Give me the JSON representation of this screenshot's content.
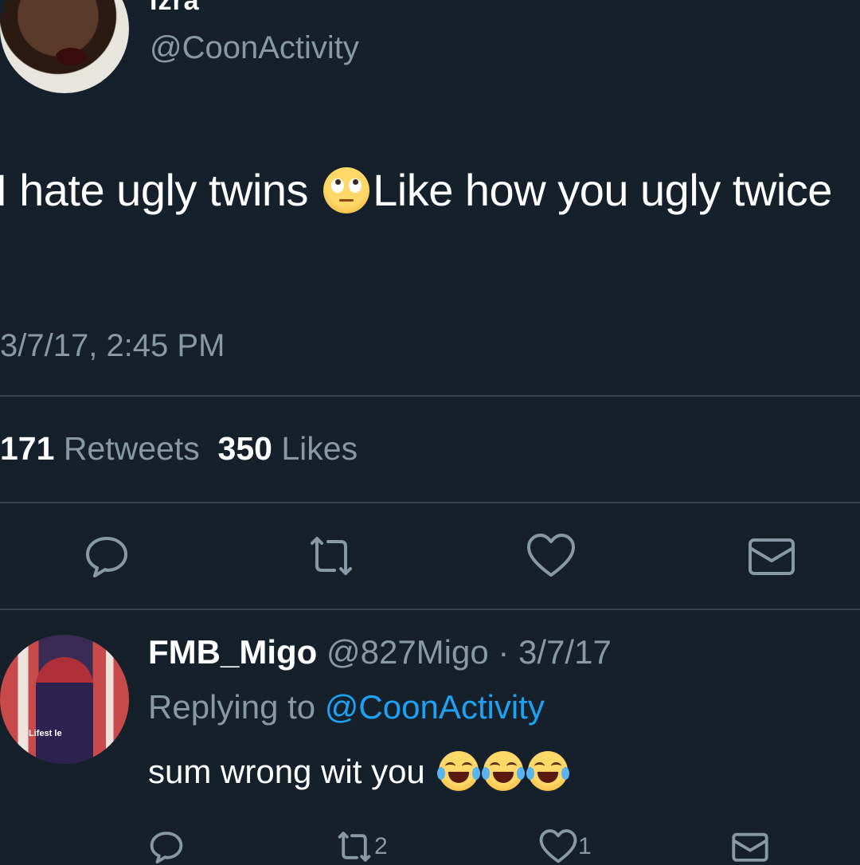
{
  "tweet": {
    "display_name": "Izra",
    "handle": "@CoonActivity",
    "text_part1": "I hate ugly twins ",
    "text_part2": "Like how you ugly twice",
    "emoji": "face-with-rolling-eyes",
    "timestamp": "3/7/17, 2:45 PM",
    "retweets_count": "171",
    "retweets_label": "Retweets",
    "likes_count": "350",
    "likes_label": "Likes"
  },
  "reply": {
    "display_name": "FMB_Migo",
    "handle": "@827Migo",
    "separator": " · ",
    "date": "3/7/17",
    "replying_prefix": "Replying to ",
    "replying_handle": "@CoonActivity",
    "text": "sum wrong wit you ",
    "emojis": [
      "face-with-tears-of-joy",
      "face-with-tears-of-joy",
      "face-with-tears-of-joy"
    ],
    "retweet_count": "2",
    "like_count": "1"
  },
  "colors": {
    "background": "#15202b",
    "text": "#ffffff",
    "muted": "#8899a6",
    "link": "#1da1f2",
    "divider": "#38444d"
  },
  "icons": [
    "reply-icon",
    "retweet-icon",
    "like-icon",
    "dm-icon"
  ]
}
